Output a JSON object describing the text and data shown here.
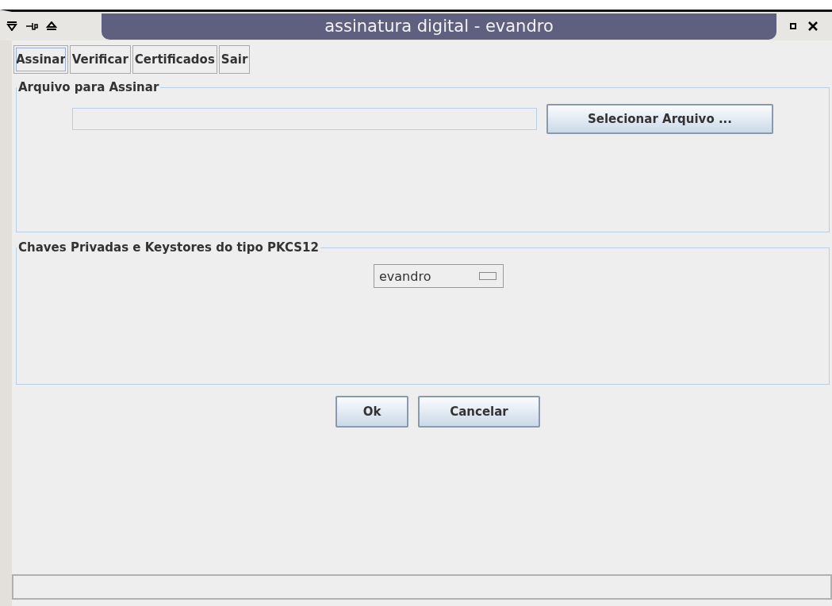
{
  "window": {
    "title": "assinatura digital - evandro"
  },
  "tabs": [
    {
      "label": "Assinar",
      "selected": true
    },
    {
      "label": "Verificar",
      "selected": false
    },
    {
      "label": "Certificados",
      "selected": false
    },
    {
      "label": "Sair",
      "selected": false
    }
  ],
  "file_panel": {
    "title": "Arquivo para Assinar",
    "button": "Selecionar Arquivo ..."
  },
  "keys_panel": {
    "title": "Chaves Privadas e Keystores do tipo PKCS12",
    "keystore": "evandro"
  },
  "buttons": [
    "Ok",
    "Cancelar"
  ]
}
